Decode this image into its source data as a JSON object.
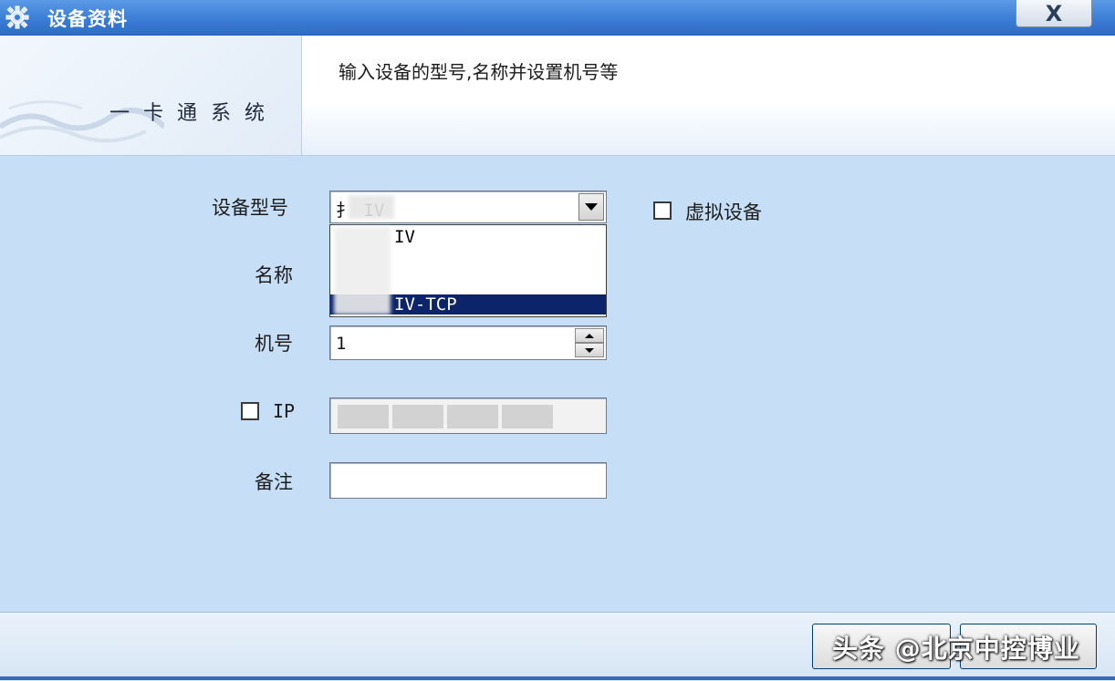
{
  "window": {
    "title": "设备资料",
    "close_label": "X"
  },
  "header": {
    "system_name": "一卡通系统",
    "description": "输入设备的型号,名称并设置机号等"
  },
  "form": {
    "device_model": {
      "label": "设备型号",
      "value": "扌  IV",
      "options": [
        "IV",
        "",
        "",
        "IV-TCP"
      ],
      "selected_index": 3
    },
    "virtual_device": {
      "label": "虚拟设备",
      "checked": false
    },
    "name": {
      "label": "名称",
      "value": ""
    },
    "machine_no": {
      "label": "机号",
      "value": "1"
    },
    "ip": {
      "label": "IP",
      "checked": false
    },
    "remark": {
      "label": "备注",
      "value": ""
    }
  },
  "footer": {
    "watermark": "头条 @北京中控博业"
  },
  "colors": {
    "titlebar": "#3a7bd5",
    "form_bg": "#c7dff6",
    "selection": "#0c246a"
  }
}
